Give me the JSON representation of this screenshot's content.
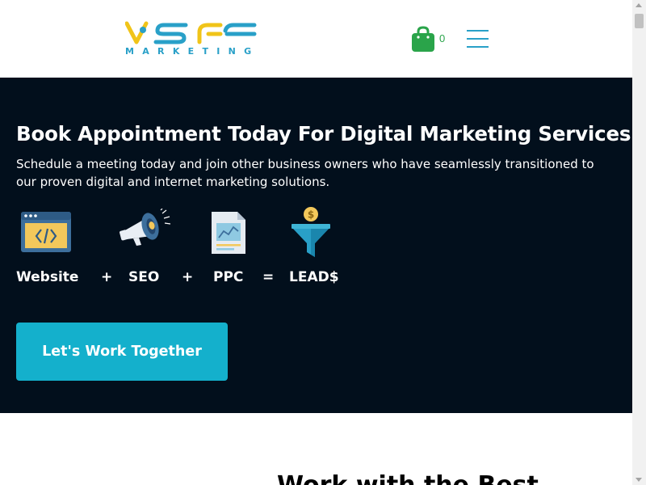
{
  "header": {
    "logo_text": "VSF",
    "logo_subtext": "MARKETING",
    "cart_count": "0",
    "colors": {
      "logo_blue": "#29a0c8",
      "logo_yellow": "#f0c419",
      "cart_green": "#2aa44a"
    }
  },
  "hero": {
    "title": "Book Appointment Today For Digital Marketing Services",
    "subtitle": "Schedule a meeting today and join other business owners who have seamlessly transitioned to our proven digital and internet marketing solutions.",
    "equation": [
      {
        "label": "Website",
        "icon": "website-code-icon"
      },
      {
        "op": "+"
      },
      {
        "label": "SEO",
        "icon": "megaphone-icon"
      },
      {
        "op": "+"
      },
      {
        "label": "PPC",
        "icon": "ppc-document-icon"
      },
      {
        "op": "="
      },
      {
        "label": "LEAD$",
        "icon": "funnel-dollar-icon"
      }
    ],
    "cta_label": "Let's Work Together",
    "colors": {
      "background": "#020f1c",
      "cta": "#14b0cc"
    }
  },
  "next_section": {
    "heading_partial": "Work with the Best"
  }
}
